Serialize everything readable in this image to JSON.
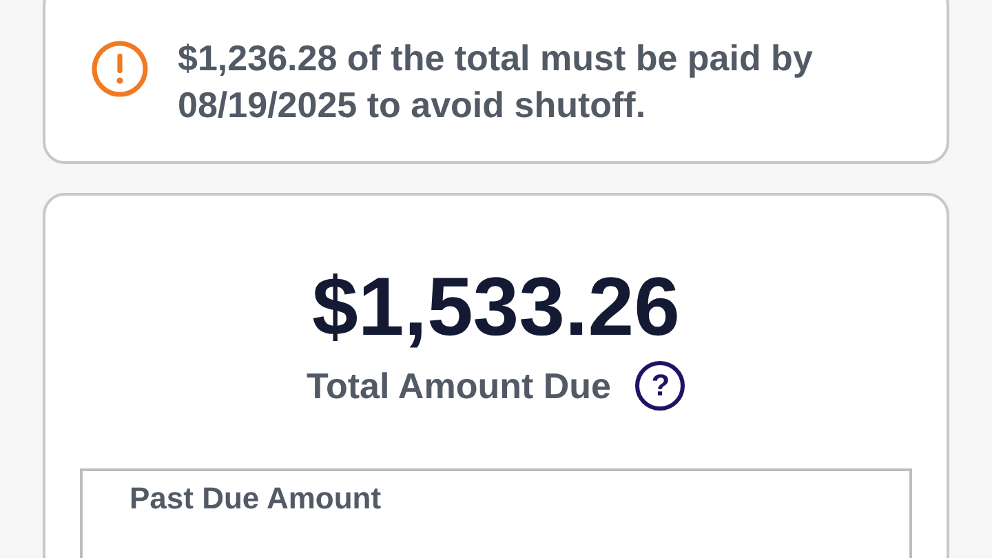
{
  "alert": {
    "message": "$1,236.28 of the total must be paid by 08/19/2025 to avoid shutoff."
  },
  "summary": {
    "amount": "$1,533.26",
    "label": "Total Amount Due",
    "help_icon": "?"
  },
  "past_due": {
    "label": "Past Due Amount"
  }
}
